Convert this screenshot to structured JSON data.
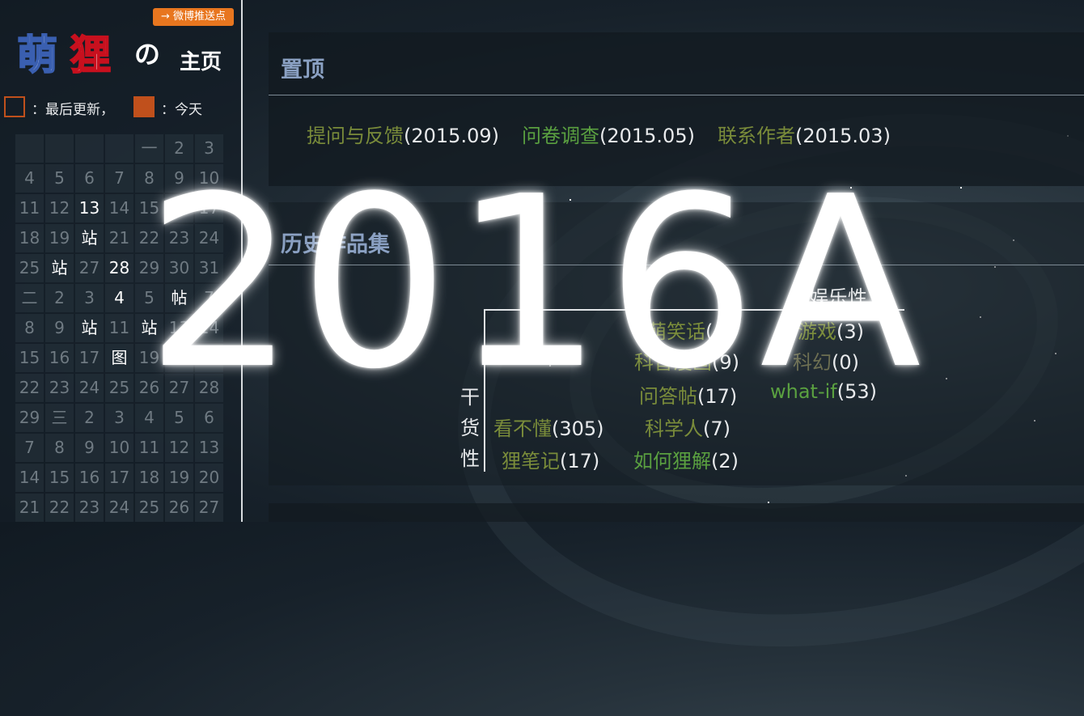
{
  "weibo_button": {
    "icon": "arrow-right-icon",
    "label": "微博推送点"
  },
  "logo": {
    "char1": "萌",
    "char2": "狸",
    "no": "の",
    "home": "主页"
  },
  "legend": {
    "last_update": "：最后更新，",
    "today": "：今天",
    "accent": "#c0501c"
  },
  "calendar": [
    "",
    "",
    "",
    "",
    "一",
    "2",
    "3",
    "4",
    "5",
    "6",
    "7",
    "8",
    "9",
    "10",
    "11",
    "12",
    "13",
    "14",
    "15",
    "16",
    "17",
    "18",
    "19",
    "站",
    "21",
    "22",
    "23",
    "24",
    "25",
    "站",
    "27",
    "28",
    "29",
    "30",
    "31",
    "二",
    "2",
    "3",
    "4",
    "5",
    "帖",
    "7",
    "8",
    "9",
    "站",
    "11",
    "站",
    "13",
    "14",
    "15",
    "16",
    "17",
    "图",
    "19",
    "20",
    "21",
    "22",
    "23",
    "24",
    "25",
    "26",
    "27",
    "28",
    "29",
    "三",
    "2",
    "3",
    "4",
    "5",
    "6",
    "7",
    "8",
    "9",
    "10",
    "11",
    "12",
    "13",
    "14",
    "15",
    "16",
    "17",
    "18",
    "19",
    "20",
    "21",
    "22",
    "23",
    "24",
    "25",
    "26",
    "27"
  ],
  "calendar_highlight": [
    16,
    23,
    29,
    31,
    38,
    40,
    44,
    46,
    52
  ],
  "pinned": {
    "title": "置顶",
    "links": [
      {
        "name": "提问与反馈",
        "date": "(2015.09)",
        "color": "#7a8c3a"
      },
      {
        "name": "问卷调查",
        "date": "(2015.05)",
        "color": "#5aa040"
      },
      {
        "name": "联系作者",
        "date": "(2015.03)",
        "color": "#7a8c3a"
      }
    ]
  },
  "history": {
    "title": "历史作品集",
    "axis_top": "娱乐性",
    "axis_left": "干货性",
    "items": {
      "meng_xiaohua": {
        "name": "萌笑话",
        "count": "(4)"
      },
      "youxi": {
        "name": "游戏",
        "count": "(3)"
      },
      "kepu_manhua": {
        "name": "科普漫画",
        "count": "(9)"
      },
      "kehuan": {
        "name": "科幻",
        "count": "(0)"
      },
      "wendatie": {
        "name": "问答帖",
        "count": "(17)"
      },
      "what_if": {
        "name": "what-if",
        "count": "(53)"
      },
      "kanbudong": {
        "name": "看不懂",
        "count": "(305)"
      },
      "kexueren": {
        "name": "科学人",
        "count": "(7)"
      },
      "libiji": {
        "name": "狸笔记",
        "count": "(17)"
      },
      "ruhe_lijie": {
        "name": "如何狸解",
        "count": "(2)"
      }
    }
  },
  "overlay_text": "2016A"
}
